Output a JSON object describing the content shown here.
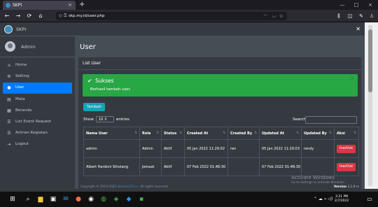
{
  "browser": {
    "tab_title": "SKPI",
    "tab_close": "×",
    "new_tab": "+",
    "url": "skp.my.id/user.php",
    "back_icon": "←",
    "forward_icon": "→",
    "reload_icon": "⟳",
    "home_icon": "⌂",
    "page_actions": "···",
    "win_min": "—",
    "win_max": "□",
    "win_close": "×"
  },
  "app": {
    "brand": "SKPI",
    "user_name": "Admin",
    "close_icon": "✕"
  },
  "sidebar": {
    "items": [
      {
        "icon": "home-icon",
        "glyph": "⌂",
        "label": "Home",
        "active": false
      },
      {
        "icon": "cogs-icon",
        "glyph": "⚙",
        "label": "Setting",
        "active": false
      },
      {
        "icon": "user-icon",
        "glyph": "●",
        "label": "User",
        "active": true
      },
      {
        "icon": "table-icon",
        "glyph": "▤",
        "label": "Mata",
        "active": false
      },
      {
        "icon": "list-icon",
        "glyph": "▦",
        "label": "Beranda",
        "active": false
      },
      {
        "icon": "list-alt-icon",
        "glyph": "☰",
        "label": "List Event Request",
        "active": false
      },
      {
        "icon": "list-alt-icon",
        "glyph": "☰",
        "label": "Antrian Kegiatan",
        "active": false
      },
      {
        "icon": "sign-out-icon",
        "glyph": "⇥",
        "label": "Logout",
        "active": false
      }
    ]
  },
  "main": {
    "page_title": "User",
    "card_title": "List User",
    "alert": {
      "check": "✔",
      "title": "Sukses",
      "message": "Berhasil tambah user.",
      "close": "×"
    },
    "add_button": "Tambah",
    "length_prefix": "Show",
    "length_value": "10",
    "length_suffix": "entries",
    "search_label": "Search:",
    "table": {
      "columns": [
        "Nama User",
        "Role",
        "Status",
        "Created At",
        "Created By",
        "Updated At",
        "Updated By",
        "Aksi"
      ],
      "rows": [
        {
          "nama": "admin",
          "role": "Admin",
          "status": "Aktif",
          "created_at": "05 Jan 2022 11:29:02",
          "created_by": "ren",
          "updated_at": "05 Jan 2022 11:29:03",
          "updated_by": "rendy",
          "aksi": "Inactive"
        },
        {
          "nama": "Albert Hardoni Sihotang",
          "role": "Jemaat",
          "status": "Aktif",
          "created_at": "07 Feb 2022 01:48:30",
          "created_by": "",
          "updated_at": "07 Feb 2022 01:48:30",
          "updated_by": "",
          "aksi": "Inactive"
        }
      ]
    }
  },
  "footer": {
    "copyright_prefix": "Copyright © 2014-2021",
    "link": "AdminLTE.io.",
    "suffix": "All rights reserved.",
    "version_label": "Version",
    "version": "3.1.0-rc"
  },
  "watermark": {
    "line1": "Activate Windows",
    "line2": "Go to Settings to activate Windows."
  },
  "taskbar": {
    "time": "3:21 PM",
    "date": "2/7/2022"
  },
  "colors": {
    "accent": "#007bff",
    "success": "#28a745",
    "danger": "#dc3545",
    "info": "#17a2b8",
    "sidebar_bg": "#343a40",
    "content_bg": "#454d55"
  }
}
